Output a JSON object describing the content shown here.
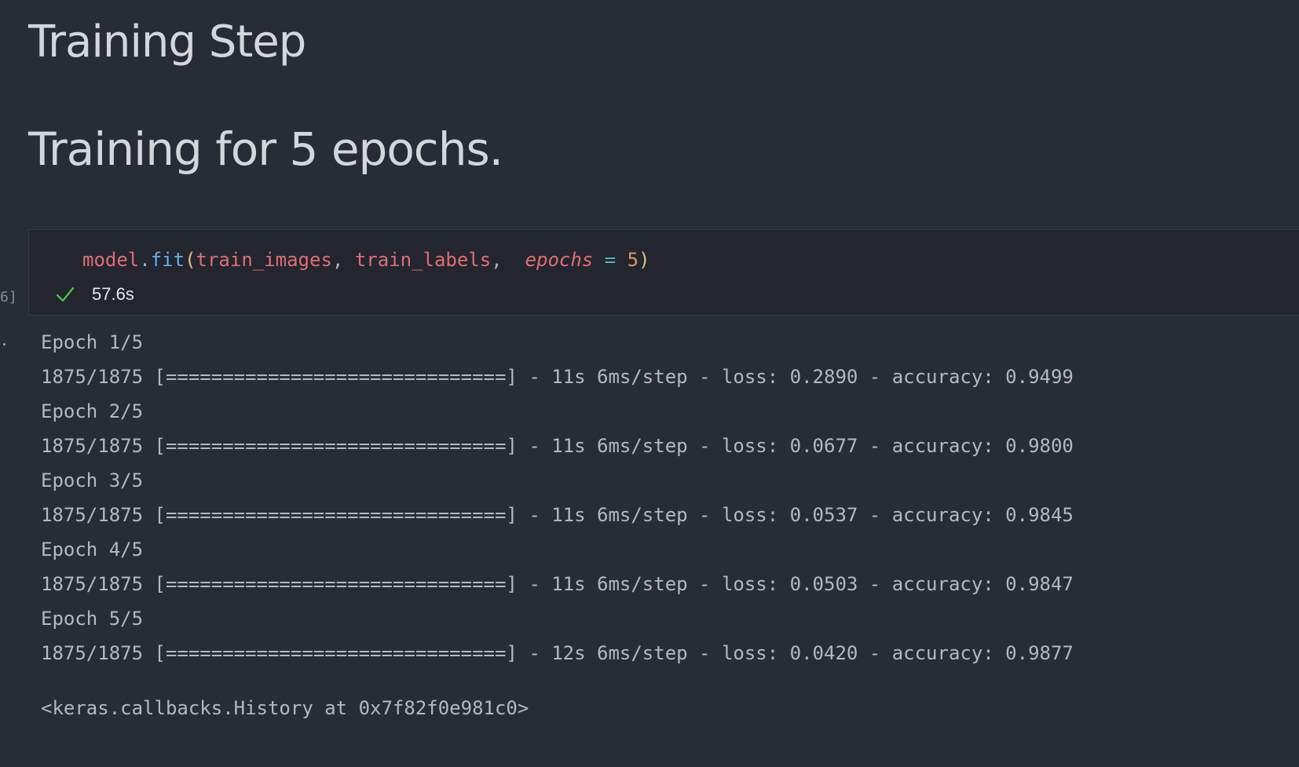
{
  "markdown": {
    "heading1": "Training Step",
    "heading2": "Training for 5 epochs."
  },
  "code_cell": {
    "tokens": {
      "obj": "model",
      "dot": ".",
      "method": "fit",
      "open_paren": "(",
      "arg1": "train_images",
      "comma1": ", ",
      "arg2": "train_labels",
      "comma2": ",  ",
      "kwarg": "epochs",
      "assign": " = ",
      "value": "5",
      "close_paren": ")"
    },
    "execution_count_fragment": "6]",
    "status_icon": "check-icon",
    "status_color": "#4ec94e",
    "exec_time": "57.6s"
  },
  "output": {
    "marker": ".",
    "lines": [
      "Epoch 1/5",
      "1875/1875 [==============================] - 11s 6ms/step - loss: 0.2890 - accuracy: 0.9499",
      "Epoch 2/5",
      "1875/1875 [==============================] - 11s 6ms/step - loss: 0.0677 - accuracy: 0.9800",
      "Epoch 3/5",
      "1875/1875 [==============================] - 11s 6ms/step - loss: 0.0537 - accuracy: 0.9845",
      "Epoch 4/5",
      "1875/1875 [==============================] - 11s 6ms/step - loss: 0.0503 - accuracy: 0.9847",
      "Epoch 5/5",
      "1875/1875 [==============================] - 12s 6ms/step - loss: 0.0420 - accuracy: 0.9877"
    ],
    "result": "<keras.callbacks.History at 0x7f82f0e981c0>"
  }
}
